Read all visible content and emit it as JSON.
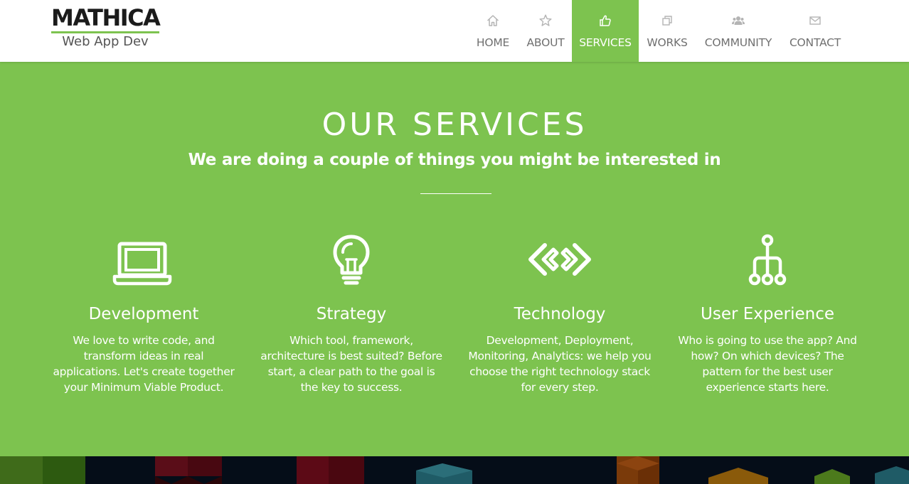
{
  "brand": {
    "name": "MATHICA",
    "tagline": "Web App Dev",
    "accent_color": "#7dc34f"
  },
  "nav": {
    "items": [
      {
        "label": "HOME",
        "icon": "home-icon"
      },
      {
        "label": "ABOUT",
        "icon": "star-icon"
      },
      {
        "label": "SERVICES",
        "icon": "thumbs-up-icon",
        "active": true
      },
      {
        "label": "WORKS",
        "icon": "copy-icon"
      },
      {
        "label": "COMMUNITY",
        "icon": "users-icon"
      },
      {
        "label": "CONTACT",
        "icon": "envelope-icon"
      }
    ]
  },
  "services": {
    "title": "OUR SERVICES",
    "subtitle": "We are doing a couple of things you might be interested in",
    "items": [
      {
        "title": "Development",
        "icon": "laptop-icon",
        "text": "We love to write code, and transform ideas in real applications. Let's create together your Minimum Viable Product."
      },
      {
        "title": "Strategy",
        "icon": "lightbulb-icon",
        "text": "Which tool, framework, architecture is best suited? Before start, a clear path to the goal is the key to success."
      },
      {
        "title": "Technology",
        "icon": "code-arrows-icon",
        "text": "Development, Deployment, Monitoring, Analytics: we help you choose the right technology stack for every step."
      },
      {
        "title": "User Experience",
        "icon": "sitemap-icon",
        "text": "Who is going to use the app? And how? On which devices? The pattern for the best user experience starts here."
      }
    ]
  }
}
